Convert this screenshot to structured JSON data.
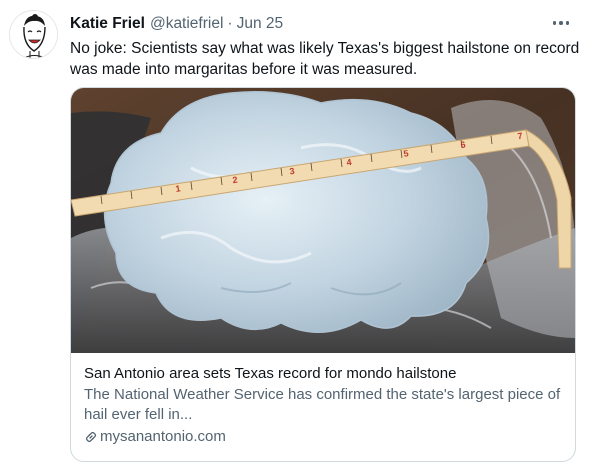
{
  "tweet": {
    "author_name": "Katie Friel",
    "author_handle": "@katiefriel",
    "separator": "·",
    "date": "Jun 25",
    "text": "No joke: Scientists say what was likely Texas's biggest hailstone on record was made into margaritas before it was measured."
  },
  "card": {
    "title": "San Antonio area sets Texas record for mondo hailstone",
    "description": "The National Weather Service has confirmed the state's largest piece of hail ever fell in...",
    "domain": "mysanantonio.com"
  },
  "tape_numbers": [
    "1",
    "2",
    "3",
    "4",
    "5",
    "6",
    "7"
  ],
  "icons": {
    "more": "more-horizontal-icon",
    "link": "link-icon",
    "avatar": "cartoon-portrait"
  },
  "colors": {
    "secondary_text": "#536471",
    "border": "#cfd9de",
    "tape": "#f0d7ab",
    "tape_numbers": "#c0392b"
  }
}
